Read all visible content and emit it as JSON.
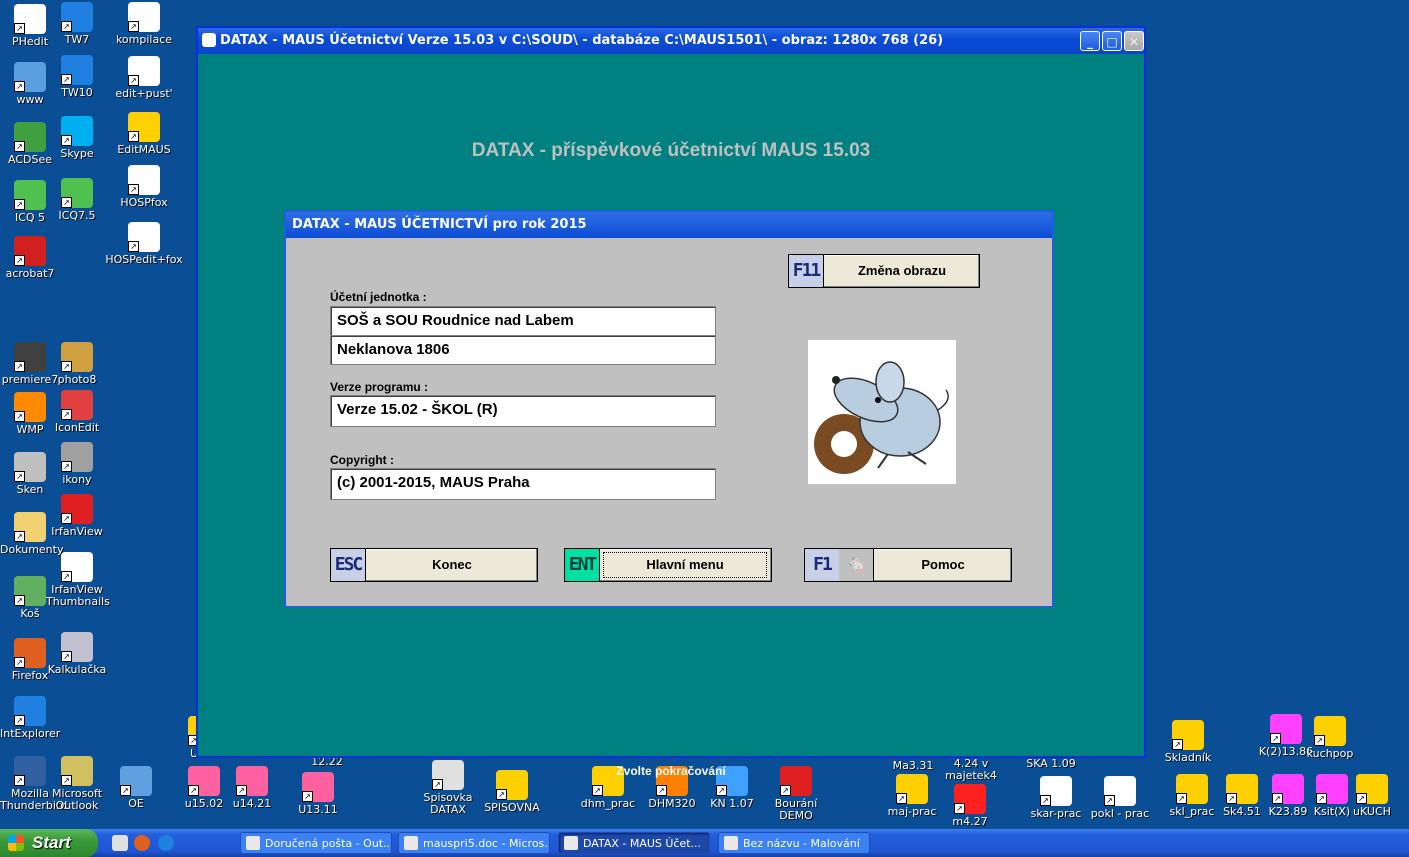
{
  "desktop_icons_left": [
    {
      "label": "PHedit",
      "icon": "document-icon",
      "color": "#ffffff"
    },
    {
      "label": "www",
      "icon": "globe-icon",
      "color": "#5aa0e0"
    },
    {
      "label": "ACDSee",
      "icon": "photo-viewer-icon",
      "color": "#40a040"
    },
    {
      "label": "ICQ 5",
      "icon": "flower-icon",
      "color": "#50c050"
    },
    {
      "label": "acrobat7",
      "icon": "acrobat-icon",
      "color": "#d02020"
    },
    {
      "label": "premiere7",
      "icon": "film-icon",
      "color": "#404040"
    },
    {
      "label": "WMP",
      "icon": "media-player-icon",
      "color": "#ff8a00"
    },
    {
      "label": "Sken",
      "icon": "scanner-icon",
      "color": "#c0c0c0"
    },
    {
      "label": "Dokumenty",
      "icon": "folder-icon",
      "color": "#f0d070"
    },
    {
      "label": "Koš",
      "icon": "recycle-bin-icon",
      "color": "#60b060"
    },
    {
      "label": "Firefox",
      "icon": "firefox-icon",
      "color": "#e06020"
    },
    {
      "label": "IntExplorer",
      "icon": "internet-explorer-icon",
      "color": "#2080e0"
    },
    {
      "label": "Mozilla Thunderbird",
      "icon": "thunderbird-icon",
      "color": "#3060a0"
    }
  ],
  "desktop_icons_col2": [
    {
      "label": "TW7",
      "icon": "teamviewer-icon",
      "color": "#2080e0"
    },
    {
      "label": "TW10",
      "icon": "teamviewer-icon",
      "color": "#2080e0"
    },
    {
      "label": "Skype",
      "icon": "skype-icon",
      "color": "#00aff0"
    },
    {
      "label": "ICQ7.5",
      "icon": "flower-icon",
      "color": "#50c050"
    },
    {
      "label": "photo8",
      "icon": "pencil-icon",
      "color": "#d0a040"
    },
    {
      "label": "IconEdit",
      "icon": "shapes-icon",
      "color": "#e04040"
    },
    {
      "label": "ikony",
      "icon": "icons-folder-icon",
      "color": "#a0a0a0"
    },
    {
      "label": "IrfanView",
      "icon": "splash-icon",
      "color": "#e02020"
    },
    {
      "label": "IrfanView Thumbnails",
      "icon": "panda-icon",
      "color": "#ffffff"
    },
    {
      "label": "Kalkulačka",
      "icon": "calculator-icon",
      "color": "#c0c0d0"
    },
    {
      "label": "Microsoft Outlook",
      "icon": "outlook-icon",
      "color": "#d0c060"
    }
  ],
  "desktop_icons_col3": [
    {
      "label": "kompilace",
      "icon": "script-icon",
      "color": "#ffffff"
    },
    {
      "label": "edit+pust'",
      "icon": "script-icon",
      "color": "#ffffff"
    },
    {
      "label": "EditMAUS",
      "icon": "bart-icon",
      "color": "#ffd000"
    },
    {
      "label": "HOSPfox",
      "icon": "script-icon",
      "color": "#ffffff"
    },
    {
      "label": "HOSPedit+fox",
      "icon": "script-icon",
      "color": "#ffffff"
    }
  ],
  "desktop_icons_bottom": [
    {
      "label": "OE",
      "icon": "outlook-express-icon",
      "color": "#60a0e0"
    },
    {
      "label": "Ukl...",
      "icon": "bart-icon",
      "color": "#ffd000"
    },
    {
      "label": "u15.02",
      "icon": "maus-icon",
      "color": "#ff60a0"
    },
    {
      "label": "u14.21",
      "icon": "maus-icon",
      "color": "#ff60a0"
    },
    {
      "label": "U13.11",
      "icon": "maus-icon",
      "color": "#ff60a0"
    },
    {
      "label": "Spisovka DATAX",
      "icon": "notepad-icon",
      "color": "#e0e0e0"
    },
    {
      "label": "SPISOVNA",
      "icon": "homer-icon",
      "color": "#ffd000"
    },
    {
      "label": "dhm_prac",
      "icon": "sunset-icon",
      "color": "#ffd000"
    },
    {
      "label": "DHM320",
      "icon": "datax-d-icon",
      "color": "#ff8000"
    },
    {
      "label": "KN 1.07",
      "icon": "datax-e-icon",
      "color": "#40a0ff"
    },
    {
      "label": "Bourání DEMO",
      "icon": "datax-b-icon",
      "color": "#e02020"
    },
    {
      "label": "maj-prac",
      "icon": "dos-icon",
      "color": "#ffd000"
    },
    {
      "label": "m4.27",
      "icon": "datax-m-icon",
      "color": "#ff2020"
    },
    {
      "label": "skar-prac",
      "icon": "skeleton-icon",
      "color": "#ffffff"
    },
    {
      "label": "pokl - prac",
      "icon": "paint-icon",
      "color": "#ffffff"
    },
    {
      "label": "skl_prac",
      "icon": "lisa-icon",
      "color": "#ffd000"
    },
    {
      "label": "Sk4.51",
      "icon": "datax-s-icon",
      "color": "#ffd000"
    },
    {
      "label": "K23.89",
      "icon": "datax-k-icon",
      "color": "#ff40ff"
    },
    {
      "label": "Ksit(X)",
      "icon": "datax-k-icon",
      "color": "#ff40ff"
    },
    {
      "label": "uKUCH",
      "icon": "bart-icon",
      "color": "#ffd000"
    },
    {
      "label": "Skladník",
      "icon": "datax-s-icon",
      "color": "#ffd000"
    },
    {
      "label": "K(2)13.86",
      "icon": "datax-k-icon",
      "color": "#ff40ff"
    },
    {
      "label": "kuchpop",
      "icon": "lisa-icon",
      "color": "#ffd000"
    }
  ],
  "desktop_top_labels": {
    "u13": "12.22",
    "ma": "Ma3.31",
    "majetek": "4.24 v majetek4",
    "ska": "SKA 1.09"
  },
  "window": {
    "title": "DATAX  -  MAUS Účetnictví Verze 15.03 v C:\\SOUD\\ - databáze C:\\MAUS1501\\ - obraz: 1280x 768 (26)",
    "headline": "DATAX - příspěvkové účetnictví MAUS 15.03",
    "footer": "Zvolte pokračování"
  },
  "dialog": {
    "title": "DATAX - MAUS ÚČETNICTVÍ pro rok 2015",
    "unit_label": "Účetní jednotka :",
    "unit_name": "SOŠ a SOU Roudnice nad Labem",
    "unit_address": "Neklanova 1806",
    "version_label": "Verze programu :",
    "version_value": "Verze 15.02 - ŠKOL (R)",
    "copyright_label": "Copyright :",
    "copyright_value": "(c) 2001-2015, MAUS Praha",
    "btn_change_key": "F11",
    "btn_change": "Změna obrazu",
    "btn_end_key": "ESC",
    "btn_end": "Konec",
    "btn_menu_key": "ENT",
    "btn_menu": "Hlavní menu",
    "btn_help_key": "F1",
    "btn_help": "Pomoc"
  },
  "taskbar": {
    "start": "Start",
    "tasks": [
      {
        "label": "Doručená pošta - Out...",
        "active": false
      },
      {
        "label": "mauspri5.doc - Micros...",
        "active": false
      },
      {
        "label": "DATAX  -  MAUS Účet...",
        "active": true
      },
      {
        "label": "Bez názvu - Malování",
        "active": false
      }
    ]
  }
}
